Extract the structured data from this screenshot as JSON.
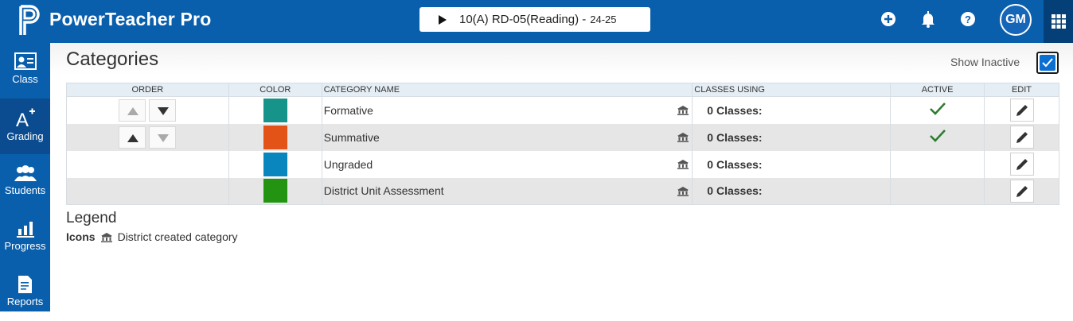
{
  "app": {
    "title": "PowerTeacher Pro"
  },
  "class_selector": {
    "label": "10(A) RD-05(Reading) -",
    "year": "24-25"
  },
  "header_icons": [
    "add-icon",
    "bell-icon",
    "help-icon"
  ],
  "user": {
    "initials": "GM"
  },
  "sidebar": {
    "items": [
      {
        "label": "Class",
        "icon": "class-icon"
      },
      {
        "label": "Grading",
        "icon": "grading-icon",
        "active": true
      },
      {
        "label": "Students",
        "icon": "students-icon"
      },
      {
        "label": "Progress",
        "icon": "progress-icon"
      },
      {
        "label": "Reports",
        "icon": "reports-icon"
      }
    ]
  },
  "page": {
    "title": "Categories",
    "show_inactive_label": "Show Inactive",
    "show_inactive_checked": true
  },
  "table": {
    "headers": {
      "order": "Order",
      "color": "Color",
      "name": "Category Name",
      "classes": "Classes Using",
      "active": "Active",
      "edit": "Edit"
    },
    "rows": [
      {
        "name": "Formative",
        "color": "#16948a",
        "classes": "0 Classes:",
        "active": true,
        "order_up_enabled": false,
        "order_down_enabled": true
      },
      {
        "name": "Summative",
        "color": "#e35217",
        "classes": "0 Classes:",
        "active": true,
        "order_up_enabled": true,
        "order_down_enabled": false
      },
      {
        "name": "Ungraded",
        "color": "#0a86be",
        "classes": "0 Classes:",
        "active": false
      },
      {
        "name": "District Unit Assessment",
        "color": "#229411",
        "classes": "0 Classes:",
        "active": false
      }
    ]
  },
  "legend": {
    "title": "Legend",
    "icons_label": "Icons",
    "district_text": "District created category"
  },
  "colors": {
    "brand": "#0a5fad",
    "active_check": "#2e7d32"
  }
}
